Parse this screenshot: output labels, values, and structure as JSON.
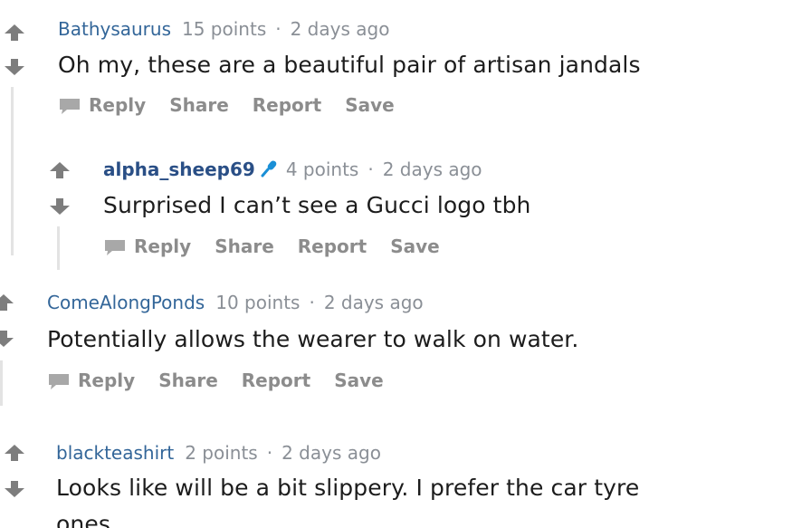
{
  "comments": [
    {
      "author": "Bathysaurus",
      "points": "15 points",
      "dot": "·",
      "time": "2 days ago",
      "body": "Oh my, these are a beautiful pair of artisan jandals"
    },
    {
      "author": "alpha_sheep69",
      "points": "4 points",
      "dot": "·",
      "time": "2 days ago",
      "body": "Surprised I can’t see a Gucci logo tbh"
    },
    {
      "author": "ComeAlongPonds",
      "points": "10 points",
      "dot": "·",
      "time": "2 days ago",
      "body": "Potentially allows the wearer to walk on water."
    },
    {
      "author": "blackteashirt",
      "points": "2 points",
      "dot": "·",
      "time": "2 days ago",
      "body": "Looks like will be a bit slippery. I prefer the car tyre",
      "body_cont": "ones"
    }
  ],
  "actions": {
    "reply": "Reply",
    "share": "Share",
    "report": "Report",
    "save": "Save"
  },
  "colors": {
    "arrow": "#7d7d7d",
    "author": "#336699",
    "op_author": "#2a4f86",
    "mic": "#1a8fd6",
    "thread_line": "#e3e3e3"
  },
  "icons": {
    "upvote": "up-arrow-icon",
    "downvote": "down-arrow-icon",
    "reply": "speech-bubble-icon",
    "mic": "microphone-icon"
  }
}
